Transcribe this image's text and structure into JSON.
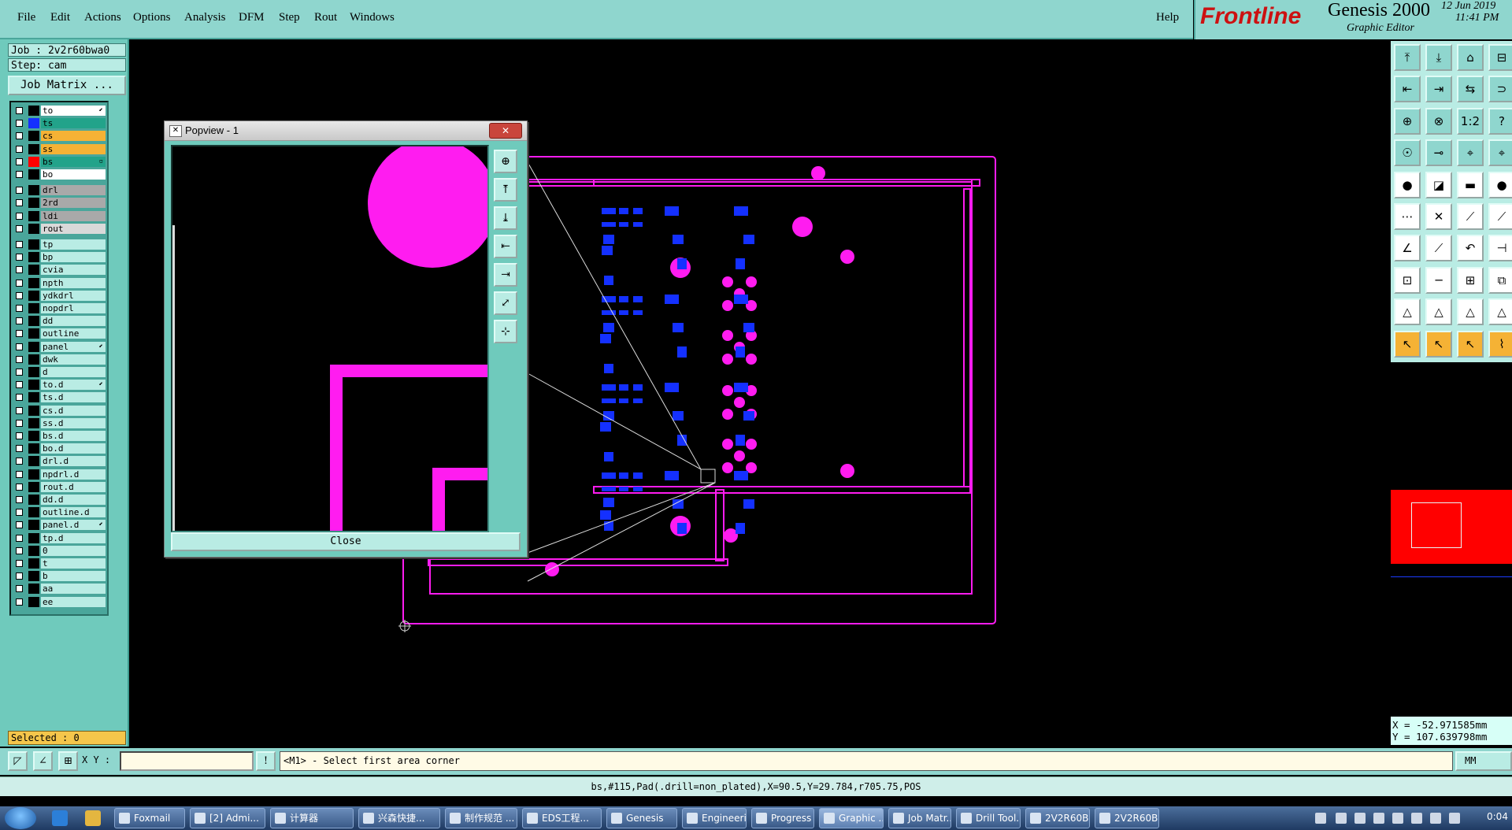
{
  "menu": {
    "items": [
      "File",
      "Edit",
      "Actions",
      "Options",
      "Analysis",
      "DFM",
      "Step",
      "Rout",
      "Windows"
    ],
    "help": "Help"
  },
  "brand": {
    "logo": "Frontline",
    "product": "Genesis 2000",
    "subtitle": "Graphic Editor",
    "date": "12 Jun 2019",
    "time": "11:41 PM"
  },
  "job": {
    "job_label": "Job : 2v2r60bwa0",
    "step_label": "Step: cam",
    "matrix_button": "Job Matrix ..."
  },
  "layers": [
    {
      "name": "to",
      "sw": "#000",
      "bg": "#ffffff",
      "mark": "⬋",
      "checked": false
    },
    {
      "name": "ts",
      "sw": "#1430ff",
      "bg": "#22a38a",
      "mark": "",
      "checked": false
    },
    {
      "name": "cs",
      "sw": "#000",
      "bg": "#f5b235",
      "mark": "",
      "checked": false
    },
    {
      "name": "ss",
      "sw": "#000",
      "bg": "#f5b235",
      "mark": "",
      "checked": false
    },
    {
      "name": "bs",
      "sw": "#ff0000",
      "bg": "#22a38a",
      "mark": "▫",
      "checked": true
    },
    {
      "name": "bo",
      "sw": "#000",
      "bg": "#ffffff",
      "mark": "",
      "checked": false
    },
    {
      "name": "drl",
      "sw": "#000",
      "bg": "#a9a9a9",
      "mark": "",
      "checked": false
    },
    {
      "name": "2rd",
      "sw": "#000",
      "bg": "#a9a9a9",
      "mark": "",
      "checked": false
    },
    {
      "name": "ldi",
      "sw": "#000",
      "bg": "#a9a9a9",
      "mark": "",
      "checked": false
    },
    {
      "name": "rout",
      "sw": "#000",
      "bg": "#d9d9d9",
      "mark": "",
      "checked": false
    },
    {
      "name": "tp",
      "sw": "#000",
      "bg": "#b9ece4",
      "mark": "",
      "checked": false
    },
    {
      "name": "bp",
      "sw": "#000",
      "bg": "#b9ece4",
      "mark": "",
      "checked": false
    },
    {
      "name": "cvia",
      "sw": "#000",
      "bg": "#b9ece4",
      "mark": "",
      "checked": false
    },
    {
      "name": "npth",
      "sw": "#000",
      "bg": "#b9ece4",
      "mark": "",
      "checked": false
    },
    {
      "name": "ydkdrl",
      "sw": "#000",
      "bg": "#b9ece4",
      "mark": "",
      "checked": false
    },
    {
      "name": "nopdrl",
      "sw": "#000",
      "bg": "#b9ece4",
      "mark": "",
      "checked": false
    },
    {
      "name": "dd",
      "sw": "#000",
      "bg": "#b9ece4",
      "mark": "",
      "checked": false
    },
    {
      "name": "outline",
      "sw": "#000",
      "bg": "#b9ece4",
      "mark": "",
      "checked": false
    },
    {
      "name": "panel",
      "sw": "#000",
      "bg": "#b9ece4",
      "mark": "⬋",
      "checked": false
    },
    {
      "name": "dwk",
      "sw": "#000",
      "bg": "#b9ece4",
      "mark": "",
      "checked": false
    },
    {
      "name": "d",
      "sw": "#000",
      "bg": "#b9ece4",
      "mark": "",
      "checked": false
    },
    {
      "name": "to.d",
      "sw": "#000",
      "bg": "#b9ece4",
      "mark": "⬋",
      "checked": false
    },
    {
      "name": "ts.d",
      "sw": "#000",
      "bg": "#b9ece4",
      "mark": "",
      "checked": false
    },
    {
      "name": "cs.d",
      "sw": "#000",
      "bg": "#b9ece4",
      "mark": "",
      "checked": false
    },
    {
      "name": "ss.d",
      "sw": "#000",
      "bg": "#b9ece4",
      "mark": "",
      "checked": false
    },
    {
      "name": "bs.d",
      "sw": "#000",
      "bg": "#b9ece4",
      "mark": "",
      "checked": false
    },
    {
      "name": "bo.d",
      "sw": "#000",
      "bg": "#b9ece4",
      "mark": "",
      "checked": false
    },
    {
      "name": "drl.d",
      "sw": "#000",
      "bg": "#b9ece4",
      "mark": "",
      "checked": false
    },
    {
      "name": "npdrl.d",
      "sw": "#000",
      "bg": "#b9ece4",
      "mark": "",
      "checked": false
    },
    {
      "name": "rout.d",
      "sw": "#000",
      "bg": "#b9ece4",
      "mark": "",
      "checked": false
    },
    {
      "name": "dd.d",
      "sw": "#000",
      "bg": "#b9ece4",
      "mark": "",
      "checked": false
    },
    {
      "name": "outline.d",
      "sw": "#000",
      "bg": "#b9ece4",
      "mark": "",
      "checked": false
    },
    {
      "name": "panel.d",
      "sw": "#000",
      "bg": "#b9ece4",
      "mark": "⬋",
      "checked": false
    },
    {
      "name": "tp.d",
      "sw": "#000",
      "bg": "#b9ece4",
      "mark": "",
      "checked": false
    },
    {
      "name": "0",
      "sw": "#000",
      "bg": "#b9ece4",
      "mark": "",
      "checked": false
    },
    {
      "name": "t",
      "sw": "#000",
      "bg": "#b9ece4",
      "mark": "",
      "checked": false
    },
    {
      "name": "b",
      "sw": "#000",
      "bg": "#b9ece4",
      "mark": "",
      "checked": false
    },
    {
      "name": "aa",
      "sw": "#000",
      "bg": "#b9ece4",
      "mark": "",
      "checked": false
    },
    {
      "name": "ee",
      "sw": "#000",
      "bg": "#b9ece4",
      "mark": "",
      "checked": false
    }
  ],
  "selected": "Selected : 0",
  "popview": {
    "title": "Popview - 1",
    "close_label": "Close",
    "tools": [
      "zoom-in-icon",
      "up-icon",
      "down-icon",
      "left-icon",
      "right-icon",
      "fit-icon",
      "center-icon"
    ]
  },
  "right_tools": [
    [
      "⤒",
      "⤓",
      "⌂",
      "⊟"
    ],
    [
      "⇤",
      "⇥",
      "⇆",
      "⊃"
    ],
    [
      "⊕",
      "⊗",
      "1:2",
      "?"
    ],
    [
      "☉",
      "⊸",
      "⌖",
      "⌖"
    ],
    [
      "●",
      "◪",
      "▬",
      "●"
    ],
    [
      "⋯",
      "✕",
      "⟋",
      "⟋"
    ],
    [
      "∠",
      "⟋",
      "↶",
      "⊣"
    ],
    [
      "⊡",
      "─",
      "⊞",
      "⧉"
    ],
    [
      "△",
      "△",
      "△",
      "△"
    ],
    [
      "↖",
      "↖",
      "↖",
      "⌇"
    ]
  ],
  "coords": {
    "x": "X = -52.971585mm",
    "y": "Y = 107.639798mm"
  },
  "prompt": {
    "xy_label": "X Y :",
    "xy_value": "",
    "message": "<M1> - Select first area corner",
    "units": "MM"
  },
  "status_line": "bs,#115,Pad(.drill=non_plated),X=90.5,Y=29.784,r705.75,POS",
  "taskbar": {
    "tasks": [
      "Foxmail",
      "[2] Admi...",
      "计算器",
      "兴森快捷...",
      "制作规范 ...",
      "EDS工程...",
      "Genesis",
      "Engineeri...",
      "Progress",
      "Graphic ...",
      "Job Matr...",
      "Drill Tool...",
      "2V2R60B...",
      "2V2R60B..."
    ],
    "active_index": 9,
    "clock": "0:04"
  },
  "colors": {
    "accent": "#8fd6ce",
    "pad_magenta": "#ff1cf0",
    "pad_blue": "#1430ff",
    "selection_red": "#ff0000"
  }
}
